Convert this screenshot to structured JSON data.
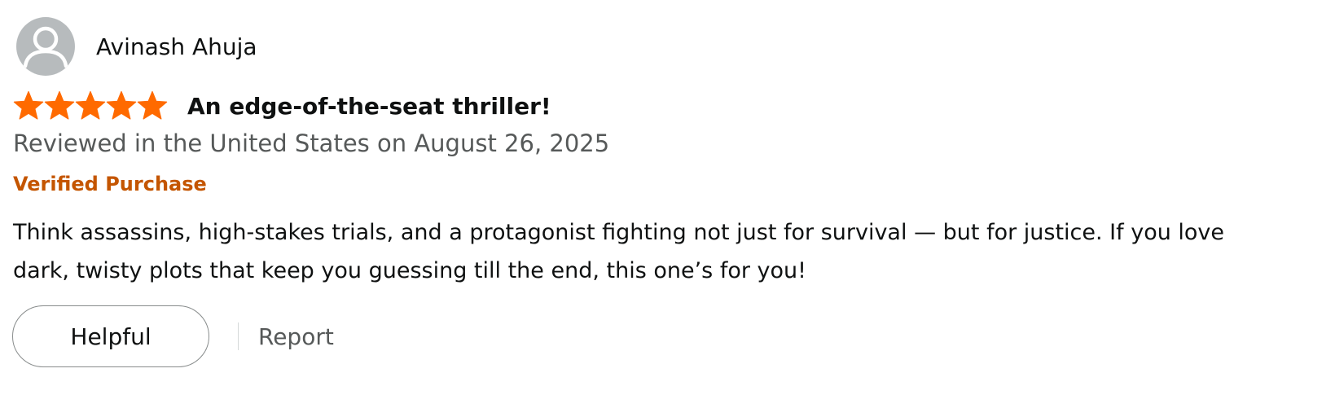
{
  "review": {
    "reviewer_name": "Avinash Ahuja",
    "rating": 5,
    "rating_max": 5,
    "title": "An edge-of-the-seat thriller!",
    "date_line": "Reviewed in the United States on August 26, 2025",
    "verified_label": "Verified Purchase",
    "body": "Think assassins, high-stakes trials, and a protagonist fighting not just for survival — but for justice. If you love dark, twisty plots that keep you guessing till the end, this one’s for you!"
  },
  "actions": {
    "helpful_label": "Helpful",
    "report_label": "Report"
  },
  "icons": {
    "avatar": "user-silhouette-icon",
    "star": "filled-star-icon"
  },
  "colors": {
    "star": "#ff6a00",
    "verified": "#c45500",
    "secondary_text": "#565959",
    "avatar_bg": "#b7bbbd"
  }
}
